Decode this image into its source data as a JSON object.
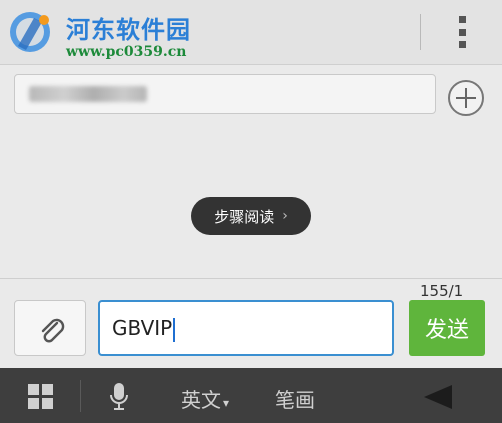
{
  "watermark": {
    "site_name": "河东软件园",
    "site_url": "www.pc0359.cn"
  },
  "header": {
    "menu_icon": "overflow-menu-icon"
  },
  "recipient": {
    "add_icon": "plus-circle-icon"
  },
  "toast": {
    "label": "步骤阅读",
    "chevron": "›"
  },
  "compose": {
    "char_counter": "155/1",
    "message_text": "GBVIP",
    "attach_icon": "paperclip-icon",
    "send_label": "发送",
    "send_color": "#5fb53c",
    "input_border_color": "#3a8fd1"
  },
  "keyboard_bar": {
    "grid_icon": "grid-icon",
    "mic_icon": "microphone-icon",
    "lang_label": "英文",
    "lang_arrow": "▾",
    "stroke_label": "笔画",
    "hide_icon": "hide-keyboard-icon"
  }
}
